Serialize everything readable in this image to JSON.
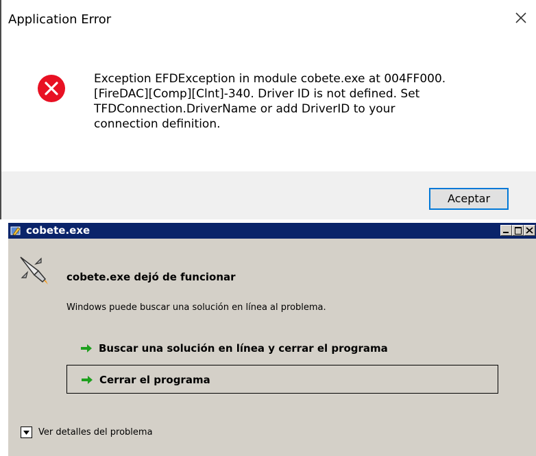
{
  "app_error": {
    "title": "Application Error",
    "message_lines": [
      "Exception EFDException in module cobete.exe at 004FF000.",
      "[FireDAC][Comp][Clnt]-340. Driver ID is not defined. Set",
      "TFDConnection.DriverName or add DriverID to your",
      "connection definition."
    ],
    "ok_label": "Aceptar",
    "icons": {
      "error": "error-icon",
      "close": "close-icon"
    },
    "colors": {
      "error_red": "#e81123",
      "focus_border": "#0078d7"
    }
  },
  "crash_dialog": {
    "title": "cobete.exe",
    "heading": "cobete.exe dejó de funcionar",
    "subtext": "Windows puede buscar una solución en línea al problema.",
    "options": [
      {
        "label": "Buscar una solución en línea y cerrar el programa",
        "icon": "green-arrow-icon"
      },
      {
        "label": "Cerrar el programa",
        "icon": "green-arrow-icon"
      }
    ],
    "details_label": "Ver detalles del problema",
    "colors": {
      "titlebar": "#0a246a",
      "body": "#d4d0c8",
      "arrow": "#1ea01e"
    }
  }
}
